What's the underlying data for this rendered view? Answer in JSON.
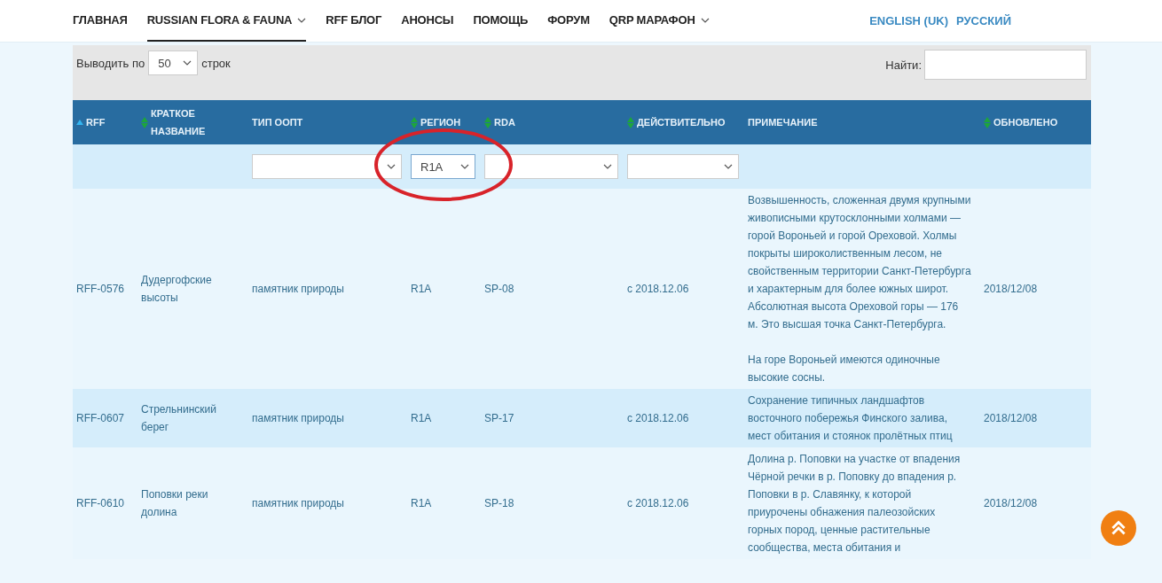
{
  "nav": {
    "items": [
      {
        "label": "ГЛАВНАЯ",
        "selected": false,
        "dropdown": false
      },
      {
        "label": "RUSSIAN FLORA & FAUNA",
        "selected": true,
        "dropdown": true
      },
      {
        "label": "RFF БЛОГ",
        "selected": false,
        "dropdown": false
      },
      {
        "label": "АНОНСЫ",
        "selected": false,
        "dropdown": false
      },
      {
        "label": "ПОМОЩЬ",
        "selected": false,
        "dropdown": false
      },
      {
        "label": "ФОРУМ",
        "selected": false,
        "dropdown": false
      },
      {
        "label": "QRP МАРАФОН",
        "selected": false,
        "dropdown": true
      }
    ],
    "languages": [
      "ENGLISH (UK)",
      "РУССКИЙ"
    ]
  },
  "length_control": {
    "before": "Выводить по",
    "value": "50",
    "after": "строк"
  },
  "search": {
    "label": "Найти:"
  },
  "table": {
    "columns": [
      {
        "label": "RFF",
        "sortable": true,
        "sorted": true,
        "filterable": false
      },
      {
        "label": "КРАТКОЕ НАЗВАНИЕ",
        "sortable": true,
        "sorted": false,
        "filterable": false
      },
      {
        "label": "ТИП ООПТ",
        "sortable": false,
        "sorted": false,
        "filterable": true
      },
      {
        "label": "РЕГИОН",
        "sortable": true,
        "sorted": false,
        "filterable": true,
        "filter_value": "R1A"
      },
      {
        "label": "RDA",
        "sortable": true,
        "sorted": false,
        "filterable": true
      },
      {
        "label": "ДЕЙСТВИТЕЛЬНО",
        "sortable": true,
        "sorted": false,
        "filterable": true
      },
      {
        "label": "ПРИМЕЧАНИЕ",
        "sortable": false,
        "sorted": false,
        "filterable": false
      },
      {
        "label": "ОБНОВЛЕНО",
        "sortable": true,
        "sorted": false,
        "filterable": false
      }
    ],
    "rows": [
      {
        "cells": [
          "RFF-0576",
          "Дудергофские высоты",
          "памятник природы",
          "R1A",
          "SP-08",
          "с 2018.12.06",
          [
            "Возвышенность, сложенная двумя крупными живописными крутосклонными холмами — горой Вороньей и горой Ореховой. Холмы покрыты широколиственным лесом, не свойственным территории Санкт-Петербурга и характерным для более южных широт. Абсолютная высота Ореховой горы — 176 м. Это высшая точка Санкт-Петербурга.",
            "На горе Вороньей имеются одиночные высокие сосны."
          ],
          "2018/12/08"
        ]
      },
      {
        "cells": [
          "RFF-0607",
          "Стрельнинский берег",
          "памятник природы",
          "R1A",
          "SP-17",
          "с 2018.12.06",
          [
            "Сохранение типичных ландшафтов восточного побережья Финского залива, мест обитания и стоянок пролётных птиц"
          ],
          "2018/12/08"
        ]
      },
      {
        "cells": [
          "RFF-0610",
          "Поповки реки долина",
          "памятник природы",
          "R1A",
          "SP-18",
          "с 2018.12.06",
          [
            "Долина р. Поповки на участке от впадения Чёрной речки в р. Поповку до впадения р. Поповки в р. Славянку, к которой приурочены обнажения палеозойских горных пород, ценные растительные сообщества, места обитания и"
          ],
          "2018/12/08"
        ]
      }
    ]
  },
  "annotation": {
    "kind": "ellipse"
  },
  "scroll_top_button": {
    "kind": "double-chevron"
  }
}
